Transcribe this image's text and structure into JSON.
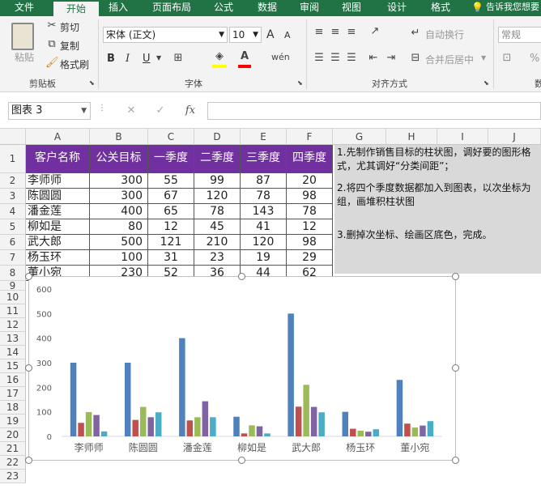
{
  "tabs": [
    "文件",
    "开始",
    "插入",
    "页面布局",
    "公式",
    "数据",
    "审阅",
    "视图",
    "设计",
    "格式"
  ],
  "active_tab": 1,
  "tell_me": "告诉我您想要",
  "ribbon": {
    "paste": "粘贴",
    "cut": "剪切",
    "copy": "复制",
    "format_painter": "格式刷",
    "clipboard_label": "剪贴板",
    "font_name": "宋体 (正文)",
    "font_size": "10",
    "grow_font": "A",
    "shrink_font": "A",
    "bold": "B",
    "italic": "I",
    "underline": "U",
    "font_label": "字体",
    "wrap_text": "自动换行",
    "merge_center": "合并后居中",
    "align_label": "对齐方式",
    "number_format": "常规",
    "percent": "%",
    "number_label": "数"
  },
  "formula_bar": {
    "name_box": "图表 3",
    "fx": "fx",
    "cancel": "✕",
    "enter": "✓",
    "value": ""
  },
  "columns": [
    "A",
    "B",
    "C",
    "D",
    "E",
    "F",
    "G",
    "H",
    "I",
    "J"
  ],
  "rows": [
    "1",
    "2",
    "3",
    "4",
    "5",
    "6",
    "7",
    "8",
    "9",
    "10",
    "11",
    "12",
    "13",
    "14",
    "15",
    "16",
    "17",
    "18",
    "19",
    "20",
    "21",
    "22",
    "23"
  ],
  "table": {
    "headers": [
      "客户名称",
      "公关目标",
      "一季度",
      "二季度",
      "三季度",
      "四季度"
    ],
    "rows": [
      [
        "李师师",
        "300",
        "55",
        "99",
        "87",
        "20"
      ],
      [
        "陈圆圆",
        "300",
        "67",
        "120",
        "78",
        "98"
      ],
      [
        "潘金莲",
        "400",
        "65",
        "78",
        "143",
        "78"
      ],
      [
        "柳如是",
        "80",
        "12",
        "45",
        "41",
        "12"
      ],
      [
        "武大郎",
        "500",
        "121",
        "210",
        "120",
        "98"
      ],
      [
        "杨玉环",
        "100",
        "31",
        "23",
        "19",
        "29"
      ],
      [
        "董小宛",
        "230",
        "52",
        "36",
        "44",
        "62"
      ]
    ]
  },
  "notes": [
    "1.先制作销售目标的柱状图，调好要的图形格式，尤其调好“分类间距”；",
    "2.将四个季度数据都加入到图表，以次坐标为组，画堆积柱状图",
    "3.删掉次坐标、绘画区底色，完成。"
  ],
  "colors": {
    "excel_green": "#217346",
    "header_purple": "#7030a0",
    "series": [
      "#4f81bd",
      "#c0504d",
      "#9bbb59",
      "#8064a2",
      "#4bacc6"
    ]
  },
  "chart_data": {
    "type": "bar",
    "categories": [
      "李师师",
      "陈圆圆",
      "潘金莲",
      "柳如是",
      "武大郎",
      "杨玉环",
      "董小宛"
    ],
    "series": [
      {
        "values": [
          300,
          300,
          400,
          80,
          500,
          100,
          230
        ]
      },
      {
        "values": [
          55,
          67,
          65,
          12,
          121,
          31,
          52
        ]
      },
      {
        "values": [
          99,
          120,
          78,
          45,
          210,
          23,
          36
        ]
      },
      {
        "values": [
          87,
          78,
          143,
          41,
          120,
          19,
          44
        ]
      },
      {
        "values": [
          20,
          98,
          78,
          12,
          98,
          29,
          62
        ]
      }
    ],
    "ylim": [
      0,
      600
    ],
    "yticks": [
      "0",
      "100",
      "200",
      "300",
      "400",
      "500",
      "600"
    ],
    "grid": false,
    "legend": "none"
  }
}
